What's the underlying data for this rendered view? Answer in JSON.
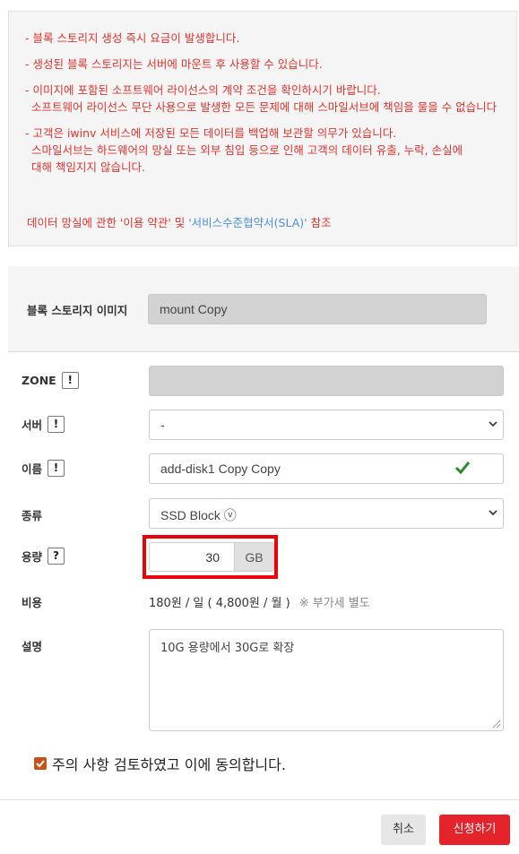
{
  "notice": {
    "lines": [
      "- 블록 스토리지 생성 즉시 요금이 발생합니다.",
      "- 생성된 블록 스토리지는 서버에 마운트 후 사용할 수 있습니다.",
      "- 이미지에 포함된 소프트웨어 라이선스의 계약 조건을 확인하시기 바랍니다.",
      "소프트웨어 라이선스 무단 사용으로 발생한 모든 문제에 대해 스마일서브에 책임을 물을 수 없습니다",
      "- 고객은 iwinv 서비스에 저장된 모든 데이터를 백업해 보관할 의무가 있습니다.",
      "스마일서브는 하드웨어의 망실 또는 외부 침입 등으로 인해 고객의 데이터 유출, 누락, 손실에",
      "대해 책임지지 않습니다."
    ],
    "footer_prefix": "데이터 망실에 관한 '이용 약관' 및 ",
    "footer_link": "'서비스수준협약서(SLA)'",
    "footer_suffix": " 참조"
  },
  "image": {
    "label": "블록 스토리지 이미지",
    "value": "mount Copy"
  },
  "zone": {
    "label": "ZONE",
    "badge": "!",
    "value": ""
  },
  "server": {
    "label": "서버",
    "badge": "!",
    "value": "-"
  },
  "name": {
    "label": "이름",
    "badge": "!",
    "value": "add-disk1 Copy Copy"
  },
  "type": {
    "label": "종류",
    "value": "SSD Block ⓥ"
  },
  "capacity": {
    "label": "용량",
    "badge": "?",
    "value": "30",
    "unit": "GB"
  },
  "cost": {
    "label": "비용",
    "value": "180원 / 일 ( 4,800원 / 월 )",
    "vat": "※ 부가세 별도"
  },
  "description": {
    "label": "설명",
    "value": "10G 용량에서 30G로 확장"
  },
  "agree": {
    "label": "주의 사항 검토하였고 이에 동의합니다.",
    "checked": true
  },
  "buttons": {
    "cancel": "취소",
    "submit": "신청하기"
  },
  "colors": {
    "accent": "#e5232a",
    "notice_text": "#e0332d",
    "link": "#4a90d9",
    "checkbox": "#c8531a"
  }
}
